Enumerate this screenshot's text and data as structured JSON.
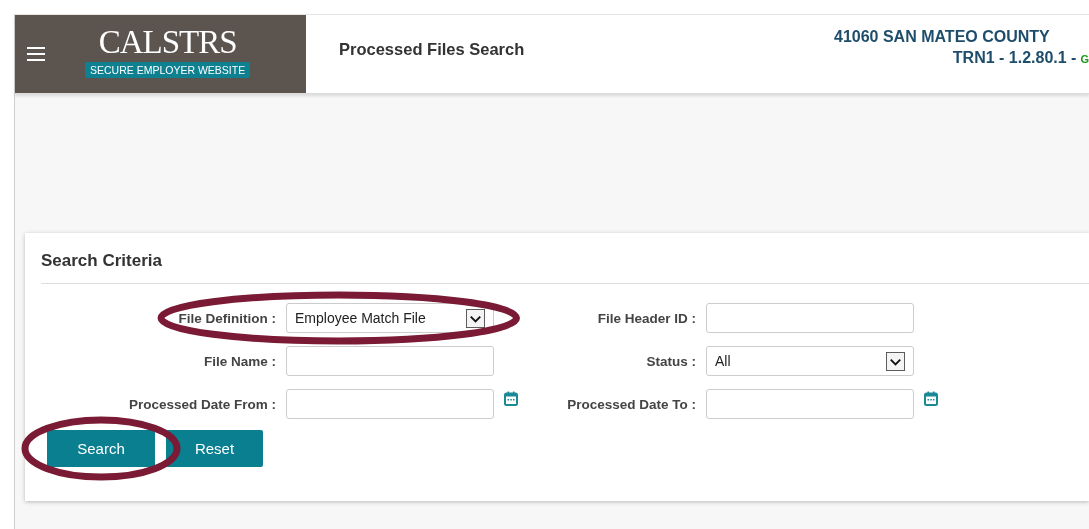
{
  "header": {
    "logo": {
      "wordmark": "CALSTRS",
      "tagline": "SECURE EMPLOYER WEBSITE"
    },
    "page_title": "Processed Files Search",
    "employer": "41060 SAN MATEO COUNTY",
    "version": "TRN1 - 1.2.80.1 -",
    "environment": "G"
  },
  "search_criteria": {
    "title": "Search Criteria",
    "fields": [
      {
        "label": "File Definition :",
        "kind": "select",
        "value": "Employee Match File",
        "highlighted": true
      },
      {
        "label": "File Header ID :",
        "kind": "text",
        "highlighted": false
      },
      {
        "label": "File Name :",
        "kind": "text",
        "highlighted": false
      },
      {
        "label": "Status :",
        "kind": "select",
        "value": "All",
        "highlighted": false
      },
      {
        "label": "Processed Date From :",
        "kind": "date",
        "highlighted": false
      },
      {
        "label": "Processed Date To :",
        "kind": "date",
        "highlighted": false
      }
    ],
    "buttons": [
      {
        "label": "Search",
        "highlighted": true
      },
      {
        "label": "Reset",
        "highlighted": false
      }
    ]
  }
}
